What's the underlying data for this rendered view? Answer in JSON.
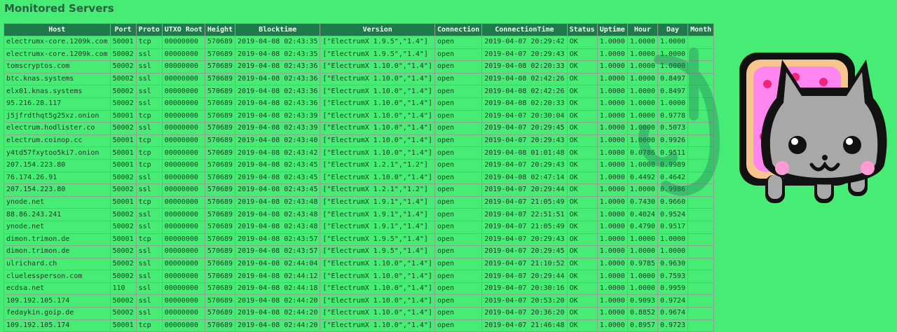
{
  "page": {
    "title": "Monitored Servers"
  },
  "table": {
    "headers": [
      "Host",
      "Port",
      "Proto",
      "UTXO Root",
      "Height",
      "Blocktime",
      "Version",
      "Connection",
      "ConnectionTime",
      "Status",
      "Uptime",
      "Hour",
      "Day",
      "Month"
    ],
    "rows": [
      [
        "electrumx-core.1209k.com",
        "50001",
        "tcp",
        "00000000",
        "570689",
        "2019-04-08 02:43:35",
        "[\"ElectrumX 1.9.5\",\"1.4\"]",
        "open",
        "2019-04-07 20:29:42",
        "OK",
        "1.0000",
        "1.0000",
        "1.0000",
        ""
      ],
      [
        "electrumx-core.1209k.com",
        "50002",
        "ssl",
        "00000000",
        "570689",
        "2019-04-08 02:43:35",
        "[\"ElectrumX 1.9.5\",\"1.4\"]",
        "open",
        "2019-04-07 20:29:43",
        "OK",
        "1.0000",
        "1.0000",
        "1.0000",
        ""
      ],
      [
        "tomscryptos.com",
        "50002",
        "ssl",
        "00000000",
        "570689",
        "2019-04-08 02:43:36",
        "[\"ElectrumX 1.10.0\",\"1.4\"]",
        "open",
        "2019-04-08 02:20:33",
        "OK",
        "1.0000",
        "1.0000",
        "1.0000",
        ""
      ],
      [
        "btc.knas.systems",
        "50002",
        "ssl",
        "00000000",
        "570689",
        "2019-04-08 02:43:36",
        "[\"ElectrumX 1.10.0\",\"1.4\"]",
        "open",
        "2019-04-08 02:42:26",
        "OK",
        "1.0000",
        "1.0000",
        "0.8497",
        ""
      ],
      [
        "elx01.knas.systems",
        "50002",
        "ssl",
        "00000000",
        "570689",
        "2019-04-08 02:43:36",
        "[\"ElectrumX 1.10.0\",\"1.4\"]",
        "open",
        "2019-04-08 02:42:26",
        "OK",
        "1.0000",
        "1.0000",
        "0.8497",
        ""
      ],
      [
        "95.216.28.117",
        "50002",
        "ssl",
        "00000000",
        "570689",
        "2019-04-08 02:43:36",
        "[\"ElectrumX 1.10.0\",\"1.4\"]",
        "open",
        "2019-04-08 02:20:33",
        "OK",
        "1.0000",
        "1.0000",
        "1.0000",
        ""
      ],
      [
        "j5jfrdthqt5g25xz.onion",
        "50001",
        "tcp",
        "00000000",
        "570689",
        "2019-04-08 02:43:39",
        "[\"ElectrumX 1.10.0\",\"1.4\"]",
        "open",
        "2019-04-07 20:30:04",
        "OK",
        "1.0000",
        "1.0000",
        "0.9778",
        ""
      ],
      [
        "electrum.hodlister.co",
        "50002",
        "ssl",
        "00000000",
        "570689",
        "2019-04-08 02:43:39",
        "[\"ElectrumX 1.10.0\",\"1.4\"]",
        "open",
        "2019-04-07 20:29:45",
        "OK",
        "1.0000",
        "1.0000",
        "0.5073",
        ""
      ],
      [
        "electrum.coinop.cc",
        "50001",
        "tcp",
        "00000000",
        "570689",
        "2019-04-08 02:43:40",
        "[\"ElectrumX 1.10.0\",\"1.4\"]",
        "open",
        "2019-04-07 20:29:43",
        "OK",
        "1.0000",
        "1.0000",
        "0.9926",
        ""
      ],
      [
        "y4td57fxytoo5ki7.onion",
        "50001",
        "tcp",
        "00000000",
        "570689",
        "2019-04-08 02:43:42",
        "[\"ElectrumX 1.10.0\",\"1.4\"]",
        "open",
        "2019-04-08 01:01:48",
        "OK",
        "1.0000",
        "0.0786",
        "0.9511",
        ""
      ],
      [
        "207.154.223.80",
        "50001",
        "tcp",
        "00000000",
        "570689",
        "2019-04-08 02:43:45",
        "[\"ElectrumX 1.2.1\",\"1.2\"]",
        "open",
        "2019-04-07 20:29:43",
        "OK",
        "1.0000",
        "1.0000",
        "0.9989",
        ""
      ],
      [
        "76.174.26.91",
        "50002",
        "ssl",
        "00000000",
        "570689",
        "2019-04-08 02:43:45",
        "[\"ElectrumX 1.10.0\",\"1.4\"]",
        "open",
        "2019-04-08 02:47:14",
        "OK",
        "1.0000",
        "0.4492",
        "0.4642",
        ""
      ],
      [
        "207.154.223.80",
        "50002",
        "ssl",
        "00000000",
        "570689",
        "2019-04-08 02:43:45",
        "[\"ElectrumX 1.2.1\",\"1.2\"]",
        "open",
        "2019-04-07 20:29:44",
        "OK",
        "1.0000",
        "1.0000",
        "0.9986",
        ""
      ],
      [
        "ynode.net",
        "50001",
        "tcp",
        "00000000",
        "570689",
        "2019-04-08 02:43:48",
        "[\"ElectrumX 1.9.1\",\"1.4\"]",
        "open",
        "2019-04-07 21:05:49",
        "OK",
        "1.0000",
        "0.7430",
        "0.9660",
        ""
      ],
      [
        "88.86.243.241",
        "50002",
        "ssl",
        "00000000",
        "570689",
        "2019-04-08 02:43:48",
        "[\"ElectrumX 1.9.1\",\"1.4\"]",
        "open",
        "2019-04-07 22:51:51",
        "OK",
        "1.0000",
        "0.4024",
        "0.9524",
        ""
      ],
      [
        "ynode.net",
        "50002",
        "ssl",
        "00000000",
        "570689",
        "2019-04-08 02:43:48",
        "[\"ElectrumX 1.9.1\",\"1.4\"]",
        "open",
        "2019-04-07 21:05:49",
        "OK",
        "1.0000",
        "0.4790",
        "0.9517",
        ""
      ],
      [
        "dimon.trimon.de",
        "50001",
        "tcp",
        "00000000",
        "570689",
        "2019-04-08 02:43:57",
        "[\"ElectrumX 1.9.5\",\"1.4\"]",
        "open",
        "2019-04-07 20:29:43",
        "OK",
        "1.0000",
        "1.0000",
        "1.0000",
        ""
      ],
      [
        "dimon.trimon.de",
        "50002",
        "ssl",
        "00000000",
        "570689",
        "2019-04-08 02:43:57",
        "[\"ElectrumX 1.9.5\",\"1.4\"]",
        "open",
        "2019-04-07 20:29:45",
        "OK",
        "1.0000",
        "1.0000",
        "1.0000",
        ""
      ],
      [
        "ulrichard.ch",
        "50002",
        "ssl",
        "00000000",
        "570689",
        "2019-04-08 02:44:04",
        "[\"ElectrumX 1.10.0\",\"1.4\"]",
        "open",
        "2019-04-07 21:10:52",
        "OK",
        "1.0000",
        "0.9785",
        "0.9630",
        ""
      ],
      [
        "cluelessperson.com",
        "50002",
        "ssl",
        "00000000",
        "570689",
        "2019-04-08 02:44:12",
        "[\"ElectrumX 1.10.0\",\"1.4\"]",
        "open",
        "2019-04-07 20:29:44",
        "OK",
        "1.0000",
        "1.0000",
        "0.7593",
        ""
      ],
      [
        "ecdsa.net",
        "110",
        "ssl",
        "00000000",
        "570689",
        "2019-04-08 02:44:18",
        "[\"ElectrumX 1.10.0\",\"1.4\"]",
        "open",
        "2019-04-07 20:30:16",
        "OK",
        "1.0000",
        "1.0000",
        "0.9959",
        ""
      ],
      [
        "109.192.105.174",
        "50002",
        "ssl",
        "00000000",
        "570689",
        "2019-04-08 02:44:20",
        "[\"ElectrumX 1.10.0\",\"1.4\"]",
        "open",
        "2019-04-07 20:53:20",
        "OK",
        "1.0000",
        "0.9093",
        "0.9724",
        ""
      ],
      [
        "fedaykin.goip.de",
        "50002",
        "ssl",
        "00000000",
        "570689",
        "2019-04-08 02:44:20",
        "[\"ElectrumX 1.10.0\",\"1.4\"]",
        "open",
        "2019-04-07 20:36:20",
        "OK",
        "1.0000",
        "0.8852",
        "0.9674",
        ""
      ],
      [
        "109.192.105.174",
        "50001",
        "tcp",
        "00000000",
        "570689",
        "2019-04-08 02:44:20",
        "[\"ElectrumX 1.10.0\",\"1.4\"]",
        "open",
        "2019-04-07 21:46:48",
        "OK",
        "1.0000",
        "0.8957",
        "0.9723",
        ""
      ]
    ]
  },
  "colors": {
    "background": "#46ec73",
    "header_bg": "#1f7a4a",
    "header_text": "#e9fff0",
    "text": "#1d3a28"
  },
  "icons": {
    "overlay": "nyan-cat-icon",
    "watermark": "electrum-logo-icon"
  }
}
